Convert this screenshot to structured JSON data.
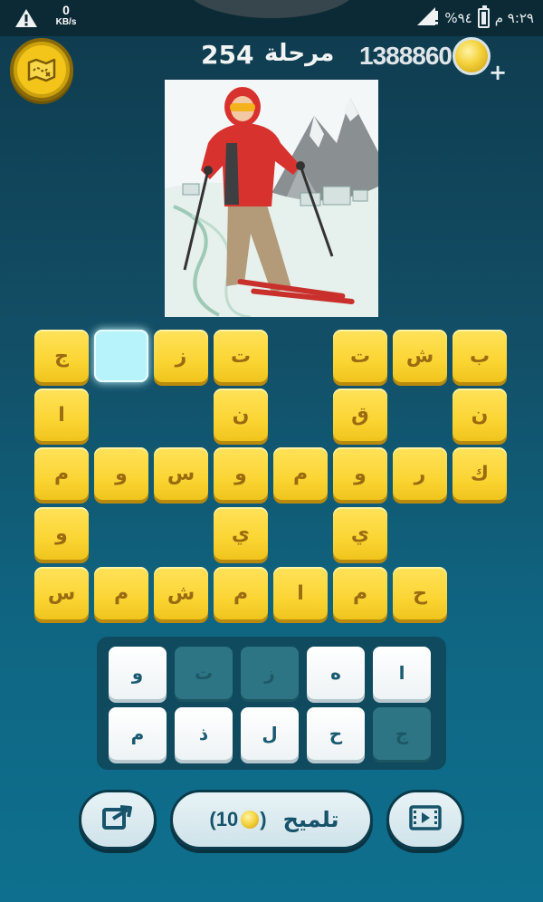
{
  "status_bar": {
    "warning_icon": "warning-icon",
    "data_speed": "0",
    "data_unit": "KB/s",
    "time": "٩:٢٩ م",
    "battery": "%٩٤",
    "signal_icon": "signal-icon"
  },
  "header": {
    "level_label": "مرحلة",
    "level_number": "254",
    "coins": "1388860",
    "map_icon": "map-icon",
    "plus_icon": "+"
  },
  "puzzle_image": "skier-illustration",
  "grid": {
    "tiles": [
      {
        "row": 0,
        "col": 8,
        "letter": "ب"
      },
      {
        "row": 0,
        "col": 7,
        "letter": "ش"
      },
      {
        "row": 0,
        "col": 6,
        "letter": "ت"
      },
      {
        "row": 0,
        "col": 4,
        "letter": "ت"
      },
      {
        "row": 0,
        "col": 3,
        "letter": "ز"
      },
      {
        "row": 0,
        "col": 2,
        "letter": "",
        "active": true
      },
      {
        "row": 0,
        "col": 1,
        "letter": "ج"
      },
      {
        "row": 1,
        "col": 8,
        "letter": "ن"
      },
      {
        "row": 1,
        "col": 6,
        "letter": "ق"
      },
      {
        "row": 1,
        "col": 4,
        "letter": "ن"
      },
      {
        "row": 1,
        "col": 1,
        "letter": "ا"
      },
      {
        "row": 2,
        "col": 8,
        "letter": "ك"
      },
      {
        "row": 2,
        "col": 7,
        "letter": "ر"
      },
      {
        "row": 2,
        "col": 6,
        "letter": "و"
      },
      {
        "row": 2,
        "col": 5,
        "letter": "م"
      },
      {
        "row": 2,
        "col": 4,
        "letter": "و"
      },
      {
        "row": 2,
        "col": 3,
        "letter": "س"
      },
      {
        "row": 2,
        "col": 2,
        "letter": "و"
      },
      {
        "row": 2,
        "col": 1,
        "letter": "م"
      },
      {
        "row": 3,
        "col": 6,
        "letter": "ي"
      },
      {
        "row": 3,
        "col": 4,
        "letter": "ي"
      },
      {
        "row": 3,
        "col": 1,
        "letter": "و"
      },
      {
        "row": 4,
        "col": 7,
        "letter": "ح"
      },
      {
        "row": 4,
        "col": 6,
        "letter": "م"
      },
      {
        "row": 4,
        "col": 5,
        "letter": "ا"
      },
      {
        "row": 4,
        "col": 4,
        "letter": "م"
      },
      {
        "row": 4,
        "col": 3,
        "letter": "ش"
      },
      {
        "row": 4,
        "col": 2,
        "letter": "م"
      },
      {
        "row": 4,
        "col": 1,
        "letter": "س"
      }
    ]
  },
  "keyboard": {
    "row1": [
      {
        "letter": "ا",
        "used": false
      },
      {
        "letter": "ه",
        "used": false
      },
      {
        "letter": "ز",
        "used": true
      },
      {
        "letter": "ت",
        "used": true
      },
      {
        "letter": "و",
        "used": false
      }
    ],
    "row2": [
      {
        "letter": "ج",
        "used": true
      },
      {
        "letter": "ح",
        "used": false
      },
      {
        "letter": "ل",
        "used": false
      },
      {
        "letter": "ذ",
        "used": false
      },
      {
        "letter": "م",
        "used": false
      }
    ]
  },
  "buttons": {
    "hint_label": "تلميح",
    "hint_cost_open": "(",
    "hint_cost": "10",
    "hint_cost_close": ")",
    "share_icon": "share-icon",
    "video_icon": "video-icon"
  },
  "colors": {
    "tile_yellow": "#fbd534",
    "tile_active": "#b7f3fb",
    "background_top": "#0f3a4d",
    "background_bottom": "#0e708e"
  }
}
